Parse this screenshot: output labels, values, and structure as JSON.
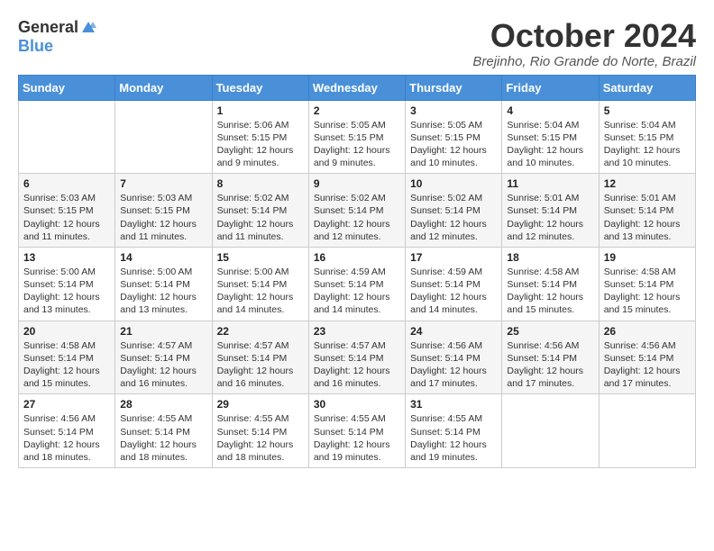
{
  "header": {
    "logo_general": "General",
    "logo_blue": "Blue",
    "month_title": "October 2024",
    "location": "Brejinho, Rio Grande do Norte, Brazil"
  },
  "days_of_week": [
    "Sunday",
    "Monday",
    "Tuesday",
    "Wednesday",
    "Thursday",
    "Friday",
    "Saturday"
  ],
  "weeks": [
    [
      {
        "day": "",
        "detail": ""
      },
      {
        "day": "",
        "detail": ""
      },
      {
        "day": "1",
        "detail": "Sunrise: 5:06 AM\nSunset: 5:15 PM\nDaylight: 12 hours and 9 minutes."
      },
      {
        "day": "2",
        "detail": "Sunrise: 5:05 AM\nSunset: 5:15 PM\nDaylight: 12 hours and 9 minutes."
      },
      {
        "day": "3",
        "detail": "Sunrise: 5:05 AM\nSunset: 5:15 PM\nDaylight: 12 hours and 10 minutes."
      },
      {
        "day": "4",
        "detail": "Sunrise: 5:04 AM\nSunset: 5:15 PM\nDaylight: 12 hours and 10 minutes."
      },
      {
        "day": "5",
        "detail": "Sunrise: 5:04 AM\nSunset: 5:15 PM\nDaylight: 12 hours and 10 minutes."
      }
    ],
    [
      {
        "day": "6",
        "detail": "Sunrise: 5:03 AM\nSunset: 5:15 PM\nDaylight: 12 hours and 11 minutes."
      },
      {
        "day": "7",
        "detail": "Sunrise: 5:03 AM\nSunset: 5:15 PM\nDaylight: 12 hours and 11 minutes."
      },
      {
        "day": "8",
        "detail": "Sunrise: 5:02 AM\nSunset: 5:14 PM\nDaylight: 12 hours and 11 minutes."
      },
      {
        "day": "9",
        "detail": "Sunrise: 5:02 AM\nSunset: 5:14 PM\nDaylight: 12 hours and 12 minutes."
      },
      {
        "day": "10",
        "detail": "Sunrise: 5:02 AM\nSunset: 5:14 PM\nDaylight: 12 hours and 12 minutes."
      },
      {
        "day": "11",
        "detail": "Sunrise: 5:01 AM\nSunset: 5:14 PM\nDaylight: 12 hours and 12 minutes."
      },
      {
        "day": "12",
        "detail": "Sunrise: 5:01 AM\nSunset: 5:14 PM\nDaylight: 12 hours and 13 minutes."
      }
    ],
    [
      {
        "day": "13",
        "detail": "Sunrise: 5:00 AM\nSunset: 5:14 PM\nDaylight: 12 hours and 13 minutes."
      },
      {
        "day": "14",
        "detail": "Sunrise: 5:00 AM\nSunset: 5:14 PM\nDaylight: 12 hours and 13 minutes."
      },
      {
        "day": "15",
        "detail": "Sunrise: 5:00 AM\nSunset: 5:14 PM\nDaylight: 12 hours and 14 minutes."
      },
      {
        "day": "16",
        "detail": "Sunrise: 4:59 AM\nSunset: 5:14 PM\nDaylight: 12 hours and 14 minutes."
      },
      {
        "day": "17",
        "detail": "Sunrise: 4:59 AM\nSunset: 5:14 PM\nDaylight: 12 hours and 14 minutes."
      },
      {
        "day": "18",
        "detail": "Sunrise: 4:58 AM\nSunset: 5:14 PM\nDaylight: 12 hours and 15 minutes."
      },
      {
        "day": "19",
        "detail": "Sunrise: 4:58 AM\nSunset: 5:14 PM\nDaylight: 12 hours and 15 minutes."
      }
    ],
    [
      {
        "day": "20",
        "detail": "Sunrise: 4:58 AM\nSunset: 5:14 PM\nDaylight: 12 hours and 15 minutes."
      },
      {
        "day": "21",
        "detail": "Sunrise: 4:57 AM\nSunset: 5:14 PM\nDaylight: 12 hours and 16 minutes."
      },
      {
        "day": "22",
        "detail": "Sunrise: 4:57 AM\nSunset: 5:14 PM\nDaylight: 12 hours and 16 minutes."
      },
      {
        "day": "23",
        "detail": "Sunrise: 4:57 AM\nSunset: 5:14 PM\nDaylight: 12 hours and 16 minutes."
      },
      {
        "day": "24",
        "detail": "Sunrise: 4:56 AM\nSunset: 5:14 PM\nDaylight: 12 hours and 17 minutes."
      },
      {
        "day": "25",
        "detail": "Sunrise: 4:56 AM\nSunset: 5:14 PM\nDaylight: 12 hours and 17 minutes."
      },
      {
        "day": "26",
        "detail": "Sunrise: 4:56 AM\nSunset: 5:14 PM\nDaylight: 12 hours and 17 minutes."
      }
    ],
    [
      {
        "day": "27",
        "detail": "Sunrise: 4:56 AM\nSunset: 5:14 PM\nDaylight: 12 hours and 18 minutes."
      },
      {
        "day": "28",
        "detail": "Sunrise: 4:55 AM\nSunset: 5:14 PM\nDaylight: 12 hours and 18 minutes."
      },
      {
        "day": "29",
        "detail": "Sunrise: 4:55 AM\nSunset: 5:14 PM\nDaylight: 12 hours and 18 minutes."
      },
      {
        "day": "30",
        "detail": "Sunrise: 4:55 AM\nSunset: 5:14 PM\nDaylight: 12 hours and 19 minutes."
      },
      {
        "day": "31",
        "detail": "Sunrise: 4:55 AM\nSunset: 5:14 PM\nDaylight: 12 hours and 19 minutes."
      },
      {
        "day": "",
        "detail": ""
      },
      {
        "day": "",
        "detail": ""
      }
    ]
  ]
}
